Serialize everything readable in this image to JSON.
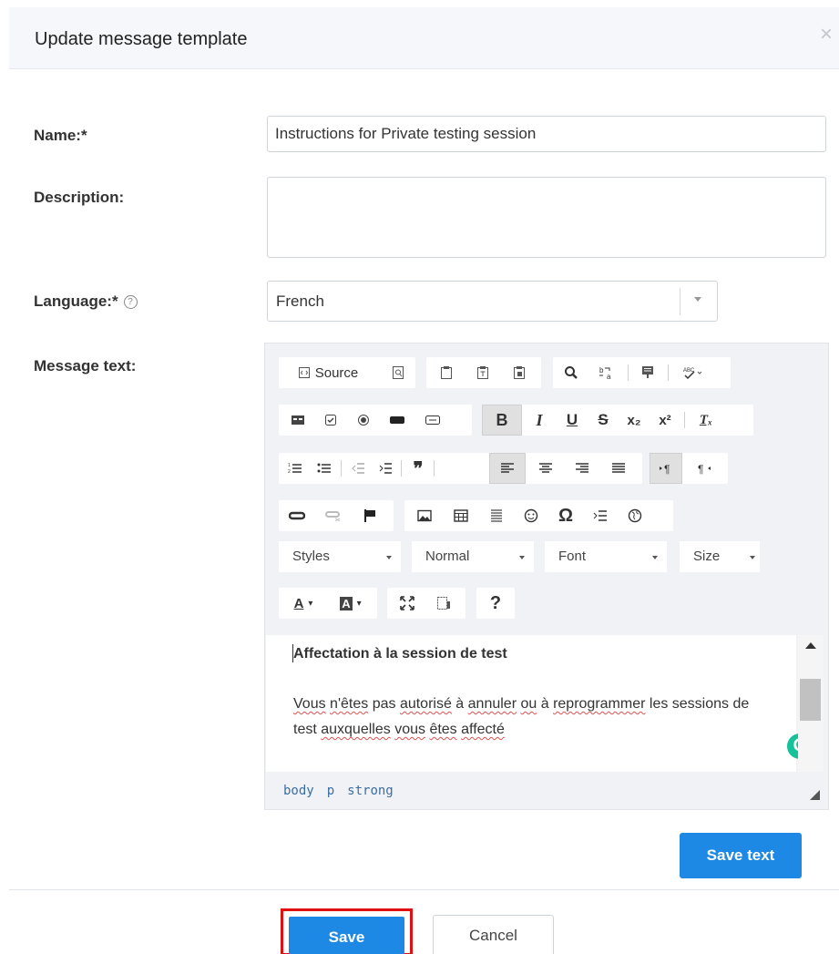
{
  "dialog": {
    "title": "Update message template",
    "close_icon": "×"
  },
  "form": {
    "name_label": "Name:*",
    "name_value": "Instructions for Private testing session",
    "description_label": "Description:",
    "description_value": "",
    "language_label": "Language:*",
    "language_help_icon": "?",
    "language_value": "French",
    "message_label": "Message text:"
  },
  "toolbar": {
    "source_label": "Source",
    "bold": "B",
    "italic": "I",
    "underline": "U",
    "strike": "S",
    "subscript": "x₂",
    "superscript": "x²",
    "remove_format": "Tₓ",
    "quote": "❞",
    "omega": "Ω",
    "help": "?",
    "styles_label": "Styles",
    "format_label": "Normal",
    "font_label": "Font",
    "size_label": "Size",
    "text_color": "A",
    "bg_color": "A"
  },
  "editor_content": {
    "heading": "Affectation à la session de test",
    "para_w1": "Vous",
    "para_w2": "n'êtes",
    "para_t1": " pas ",
    "para_w3": "autorisé",
    "para_t2": " à ",
    "para_w4": "annuler",
    "para_t3": " ",
    "para_w5": "ou",
    "para_t4": " à ",
    "para_w6": "reprogrammer",
    "para_t5": " les sessions de test ",
    "para_w7": "auxquelles",
    "para_t6": " ",
    "para_w8": "vous",
    "para_t7": " ",
    "para_w9": "êtes",
    "para_t8": " ",
    "para_w10": "affecté",
    "grammarly": "G"
  },
  "elements_path": [
    "body",
    "p",
    "strong"
  ],
  "buttons": {
    "save_text": "Save text",
    "save": "Save",
    "cancel": "Cancel"
  },
  "colors": {
    "primary": "#1e88e5",
    "highlight_border": "#e01010",
    "grammarly": "#15c39a"
  }
}
